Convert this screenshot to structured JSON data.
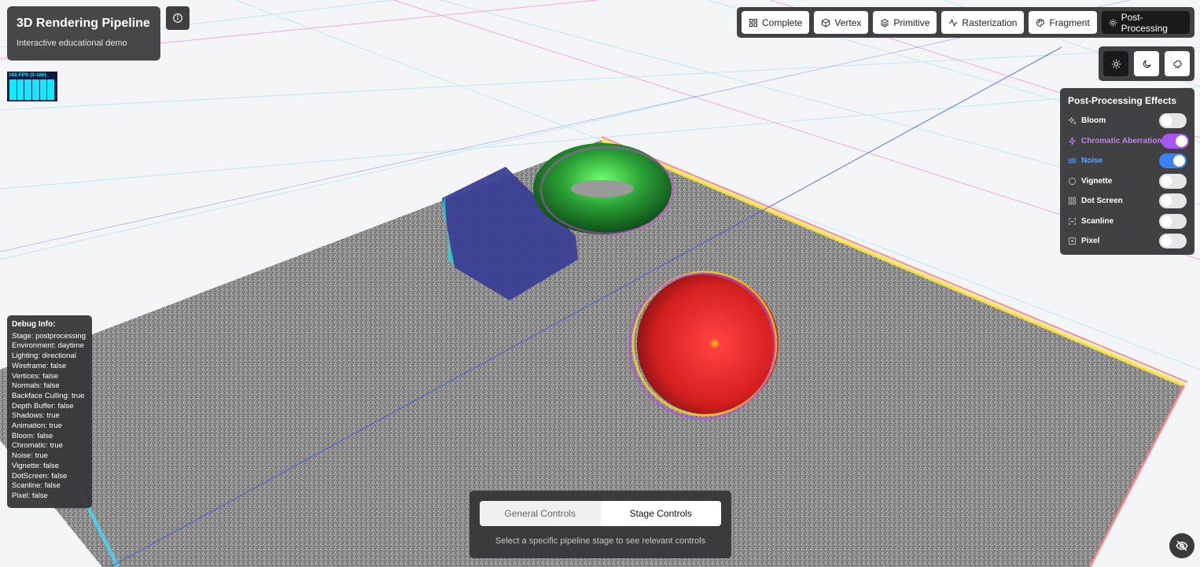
{
  "app": {
    "title": "3D Rendering Pipeline",
    "subtitle": "Interactive educational demo",
    "info_icon": "info-icon"
  },
  "fps": {
    "label": "165 FPS (0-166)"
  },
  "stages": [
    {
      "label": "Complete",
      "icon": "grid-icon",
      "active": false
    },
    {
      "label": "Vertex",
      "icon": "cube-icon",
      "active": false
    },
    {
      "label": "Primitive",
      "icon": "layers-icon",
      "active": false
    },
    {
      "label": "Rasterization",
      "icon": "activity-icon",
      "active": false
    },
    {
      "label": "Fragment",
      "icon": "palette-icon",
      "active": false
    },
    {
      "label": "Post-Processing",
      "icon": "sun-icon",
      "active": true
    }
  ],
  "environment": [
    {
      "icon": "sun-icon",
      "active": true
    },
    {
      "icon": "moon-icon",
      "active": false
    },
    {
      "icon": "cloud-rain-icon",
      "active": false
    }
  ],
  "effects": {
    "title": "Post-Processing Effects",
    "items": [
      {
        "label": "Bloom",
        "icon": "sparkles-icon",
        "enabled": false,
        "color": "#ffffff"
      },
      {
        "label": "Chromatic Aberration",
        "icon": "zap-icon",
        "enabled": true,
        "color": "#c77dff",
        "toggle_color": "#a855f7"
      },
      {
        "label": "Noise",
        "icon": "waves-icon",
        "enabled": true,
        "color": "#60a5fa",
        "toggle_color": "#3b82f6"
      },
      {
        "label": "Vignette",
        "icon": "circle-icon",
        "enabled": false,
        "color": "#ffffff"
      },
      {
        "label": "Dot Screen",
        "icon": "grid-icon",
        "enabled": false,
        "color": "#ffffff"
      },
      {
        "label": "Scanline",
        "icon": "scan-icon",
        "enabled": false,
        "color": "#ffffff"
      },
      {
        "label": "Pixel",
        "icon": "square-dot-icon",
        "enabled": false,
        "color": "#ffffff"
      }
    ]
  },
  "debug": {
    "title": "Debug Info:",
    "lines": [
      "Stage: postprocessing",
      "Environment: daytime",
      "Lighting: directional",
      "Wireframe: false",
      "Vertices: false",
      "Normals: false",
      "Backface Culling: true",
      "Depth Buffer: false",
      "Shadows: true",
      "Animation: true",
      "Bloom: false",
      "Chromatic: true",
      "Noise: true",
      "Vignette: false",
      "DotScreen: false",
      "Scanline: false",
      "Pixel: false"
    ]
  },
  "controls": {
    "tabs": [
      {
        "label": "General Controls",
        "active": false
      },
      {
        "label": "Stage Controls",
        "active": true
      }
    ],
    "hint": "Select a specific pipeline stage to see relevant controls"
  },
  "hide_ui": {
    "icon": "eye-off-icon"
  },
  "scene": {
    "floor_color": "#8a8a8a",
    "sphere_color": "#e53935",
    "torus_color": "#2e9e3a",
    "cube_color": "#3b3f95"
  }
}
